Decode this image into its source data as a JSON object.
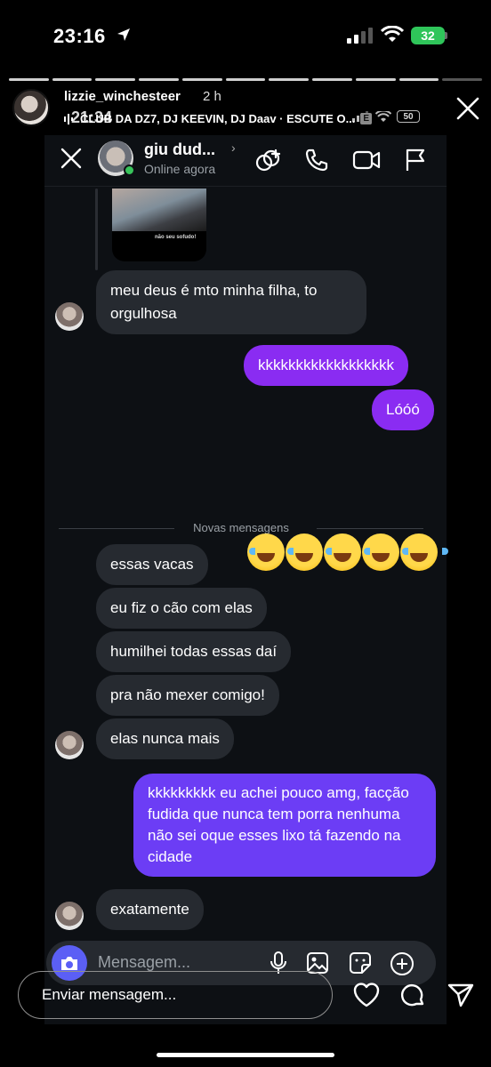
{
  "status_bar": {
    "time": "23:16",
    "battery": "32"
  },
  "story": {
    "username": "lizzie_winchesteer",
    "age": "2 h",
    "music": "CLUB DA DZ7, DJ KEEVIN, DJ Daav · ESCUTE O...",
    "explicit_badge": "E",
    "inner_time": "21:34",
    "inner_battery": "50",
    "reply_placeholder": "Enviar mensagem..."
  },
  "dm": {
    "contact_name": "giu dud...",
    "contact_status": "Online agora",
    "media_caption": "não seu sofudo!",
    "divider": "Novas mensagens",
    "composer_placeholder": "Mensagem...",
    "messages": [
      {
        "from": "them",
        "text": "meu deus é mto minha filha, to"
      },
      {
        "from": "them",
        "text": "orgulhosa"
      },
      {
        "from": "me",
        "text": "kkkkkkkkkkkkkkkkkk"
      },
      {
        "from": "me",
        "text": "Lóóó"
      },
      {
        "from": "them",
        "text": "essas vacas"
      },
      {
        "from": "them",
        "text": "eu fiz o cão com elas"
      },
      {
        "from": "them",
        "text": "humilhei todas essas daí"
      },
      {
        "from": "them",
        "text": "pra não mexer comigo!"
      },
      {
        "from": "them",
        "text": "elas nunca mais"
      },
      {
        "from": "me",
        "text": "kkkkkkkkk eu achei pouco amg, facção fudida que nunca tem porra nenhuma não sei oque esses lixo tá fazendo na cidade"
      },
      {
        "from": "them",
        "text": "exatamente"
      }
    ],
    "emoji_reaction": "😂😂😂😂😂"
  },
  "icons": [
    "location-arrow-icon",
    "signal-icon",
    "wifi-icon",
    "battery-icon",
    "close-icon",
    "explicit-icon",
    "music-bars-icon",
    "chevron-right-icon",
    "add-person-icon",
    "phone-icon",
    "video-icon",
    "flag-icon",
    "camera-icon",
    "microphone-icon",
    "image-icon",
    "sticker-icon",
    "plus-icon",
    "heart-icon",
    "comment-icon",
    "send-icon"
  ]
}
